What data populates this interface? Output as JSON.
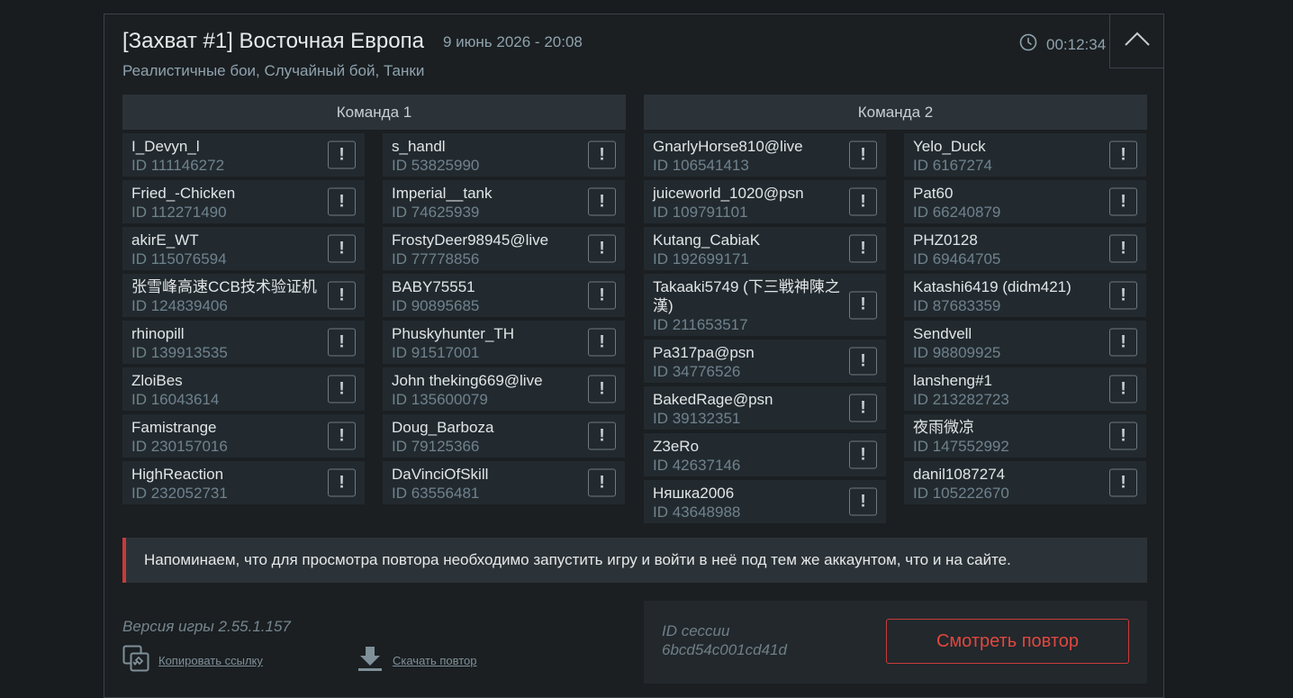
{
  "battle": {
    "title": "[Захват #1] Восточная Европа",
    "date": "9 июнь 2026 - 20:08",
    "subtitle": "Реалистичные бои, Случайный бой, Танки",
    "duration": "00:12:34"
  },
  "teams": [
    {
      "name": "Команда 1",
      "columns": [
        [
          {
            "name": "I_Devyn_l",
            "id": "ID 111146272"
          },
          {
            "name": "Fried_-Chicken",
            "id": "ID 112271490"
          },
          {
            "name": "akirE_WT",
            "id": "ID 115076594"
          },
          {
            "name": "张雪峰高速CCB技术验证机",
            "id": "ID 124839406"
          },
          {
            "name": "rhinopill",
            "id": "ID 139913535"
          },
          {
            "name": "ZloiBes",
            "id": "ID 16043614"
          },
          {
            "name": "Famistrange",
            "id": "ID 230157016"
          },
          {
            "name": "HighReaction",
            "id": "ID 232052731"
          }
        ],
        [
          {
            "name": "s_handl",
            "id": "ID 53825990"
          },
          {
            "name": "Imperial__tank",
            "id": "ID 74625939"
          },
          {
            "name": "FrostyDeer98945@live",
            "id": "ID 77778856"
          },
          {
            "name": "BABY75551",
            "id": "ID 90895685"
          },
          {
            "name": "Phuskyhunter_TH",
            "id": "ID 91517001"
          },
          {
            "name": "John theking669@live",
            "id": "ID 135600079"
          },
          {
            "name": "Doug_Barboza",
            "id": "ID 79125366"
          },
          {
            "name": "DaVinciOfSkill",
            "id": "ID 63556481"
          }
        ]
      ]
    },
    {
      "name": "Команда 2",
      "columns": [
        [
          {
            "name": "GnarlyHorse810@live",
            "id": "ID 106541413"
          },
          {
            "name": "juiceworld_1020@psn",
            "id": "ID 109791101"
          },
          {
            "name": "Kutang_CabiaK",
            "id": "ID 192699171"
          },
          {
            "name": "Takaaki5749 (下三戦神陳之漢)",
            "id": "ID 211653517"
          },
          {
            "name": "Pa317pa@psn",
            "id": "ID 34776526"
          },
          {
            "name": "BakedRage@psn",
            "id": "ID 39132351"
          },
          {
            "name": "Z3eRo",
            "id": "ID 42637146"
          },
          {
            "name": "Няшка2006",
            "id": "ID 43648988"
          }
        ],
        [
          {
            "name": "Yelo_Duck",
            "id": "ID 6167274"
          },
          {
            "name": "Pat60",
            "id": "ID 66240879"
          },
          {
            "name": "PHZ0128",
            "id": "ID 69464705"
          },
          {
            "name": "Katashi6419 (didm421)",
            "id": "ID 87683359"
          },
          {
            "name": "Sendvell",
            "id": "ID 98809925"
          },
          {
            "name": "lansheng#1",
            "id": "ID 213282723"
          },
          {
            "name": "夜雨微凉",
            "id": "ID 147552992"
          },
          {
            "name": "danil1087274",
            "id": "ID 105222670"
          }
        ]
      ]
    }
  ],
  "report_label": "!",
  "notice": "Напоминаем, что для просмотра повтора необходимо запустить игру и войти в неё под тем же аккаунтом, что и на сайте.",
  "footer": {
    "version": "Версия игры 2.55.1.157",
    "copy_link": "Копировать ссылку",
    "download": "Скачать повтор",
    "session_label": "ID сессии",
    "session_id": "6bcd54c001cd41d",
    "watch": "Смотреть повтор"
  },
  "colors": {
    "accent_red": "#c93a3a",
    "muted_text": "#8fa3ae",
    "background": "#181c1f"
  },
  "icons": {
    "timer": "clock-icon",
    "collapse": "chevron-up-icon",
    "copy": "link-copy-icon",
    "download": "download-icon"
  }
}
